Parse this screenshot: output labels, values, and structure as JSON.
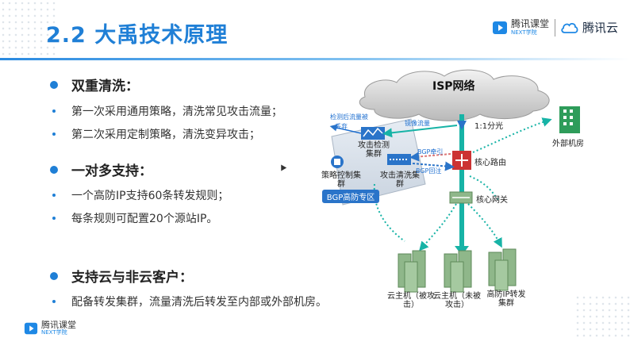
{
  "header": {
    "title": "2.2 大禹技术原理",
    "brand_keting": "腾讯课堂",
    "brand_keting_sub": "NEXT学院",
    "brand_cloud": "腾讯云"
  },
  "sections": [
    {
      "title": "双重清洗：",
      "items": [
        "第一次采用通用策略，清洗常见攻击流量；",
        "第二次采用定制策略，清洗变异攻击；"
      ]
    },
    {
      "title": "一对多支持：",
      "items": [
        "一个高防IP支持60条转发规则；",
        "每条规则可配置20个源站IP。"
      ]
    },
    {
      "title": "支持云与非云客户：",
      "items": [
        "配备转发集群，流量清洗后转发至内部或外部机房。"
      ]
    }
  ],
  "diagram": {
    "isp": "ISP网络",
    "detected_traffic_label": "检测后流量被",
    "discard_label": "丢弃",
    "mirror_traffic": "镜像流量",
    "split_ratio": "1:1分光",
    "attack_detect_cluster": "攻击检测集群",
    "policy_control_cluster": "策略控制集群",
    "attack_clean_cluster": "攻击清洗集群",
    "bgp_pull": "BGP牵引",
    "bgp_return": "BGP回注",
    "bgp_zone": "BGP高防专区",
    "core_router": "核心路由",
    "core_gateway": "核心网关",
    "external_room": "外部机房",
    "host_attacked": "云主机（被攻击）",
    "host_not_attacked": "云主机（未被攻击）",
    "forward_cluster": "高防IP转发集群"
  },
  "footer": {
    "brand": "腾讯课堂",
    "sub": "NEXT学院"
  },
  "colors": {
    "accent": "#1f7fd6",
    "teal_arrow": "#17b3a6",
    "zone_blue": "#2a74c9"
  }
}
